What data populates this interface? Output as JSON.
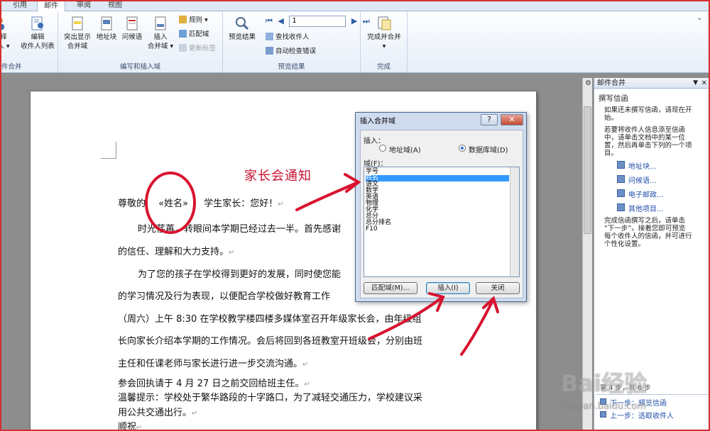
{
  "tabs": [
    {
      "label": "引用"
    },
    {
      "label": "邮件"
    },
    {
      "label": "审阅"
    },
    {
      "label": "视图"
    }
  ],
  "ribbon": {
    "group_start": {
      "label": "开始邮件合并",
      "btn_select_partial": "择",
      "btn_select_line2": "人 ▾",
      "btn_edit_line1": "编辑",
      "btn_edit_line2": "收件人列表",
      "label_partial": "件合并"
    },
    "group_write": {
      "label": "编写和插入域",
      "highlight_line1": "突出显示",
      "highlight_line2": "合并域",
      "address_block": "地址块",
      "greeting": "问候语",
      "insert_field_line1": "插入",
      "insert_field_line2": "合并域 ▾",
      "rules": "规则 ▾",
      "match_fields": "匹配域",
      "update_labels": "更新标签"
    },
    "group_preview": {
      "label": "预览结果",
      "preview_results": "预览结果",
      "record_value": "1",
      "find_recipient": "查找收件人",
      "auto_check": "自动检查错误"
    },
    "group_finish": {
      "label": "完成",
      "finish_line1": "完成并合并",
      "finish_line2": "▾"
    }
  },
  "document": {
    "line1_prefix": "尊敬的",
    "line1_field": "«姓名»",
    "line1_suffix": "学生家长：您好！",
    "line2": "时光荏苒，转眼间本学期已经过去一半。首先感谢",
    "line3": "的信任、理解和大力支持。",
    "line4": "为了您的孩子在学校得到更好的发展，同时使您能",
    "line5": "的学习情况及行为表现，以便配合学校做好教育工作",
    "line6": "（周六）上午 8:30 在学校教学楼四楼多媒体室召开年级家长会，由年级组",
    "line7": "长向家长介绍本学期的工作情况。会后将回到各班教室开班级会，分别由班",
    "line8": "主任和任课老师与家长进行进一步交流沟通。",
    "line9": "参会回执请于 4 月 27 日之前交回给班主任。",
    "line10": "温馨提示：学校处于繁华路段的十字路口，为了减轻交通压力，学校建议采",
    "line11": "用公共交通出行。",
    "line12": "顺祝",
    "para_mark": "↵"
  },
  "annotation": {
    "text": "家长会通知"
  },
  "dialog": {
    "title": "插入合并域",
    "help": "?",
    "close": "✕",
    "insert_label": "插入：",
    "option_address": "地址域(A)",
    "option_database": "数据库域(D)",
    "fields_label": "域(F)：",
    "fields": [
      "学号",
      "姓名",
      "语文",
      "数学",
      "英语",
      "物理",
      "化学",
      "总分",
      "总分排名",
      "F10"
    ],
    "selected_index": 1,
    "btn_match": "匹配域(M)...",
    "btn_insert": "插入(I)",
    "btn_close": "关闭"
  },
  "taskpane": {
    "title": "邮件合并",
    "section_title": "撰写信函",
    "p1_l1": "如果还未撰写信函，请现在开",
    "p1_l2": "始。",
    "p2_l1": "若要将收件人信息添至信函",
    "p2_l2": "中，请单击文档中的某一位",
    "p2_l3": "置，然后再单击下列的一个项",
    "p2_l4": "目。",
    "links": [
      "地址块...",
      "问候语...",
      "电子邮政...",
      "其他项目..."
    ],
    "p3_l1": "完成信函撰写之后，请单击",
    "p3_l2": "“下一步”。接着您即可预览",
    "p3_l3": "每个收件人的信函，并可进行",
    "p3_l4": "个性化设置。",
    "step_partial": "第 4 步，共 6 步",
    "next": "下一步：预览信函",
    "prev": "上一步：选取收件人"
  },
  "watermark": {
    "brand": "Bai经验",
    "url": "jingyan.baidu.com"
  },
  "colors": {
    "accent": "#c8102e",
    "selection": "#3399ff",
    "link": "#1f4ea8"
  }
}
